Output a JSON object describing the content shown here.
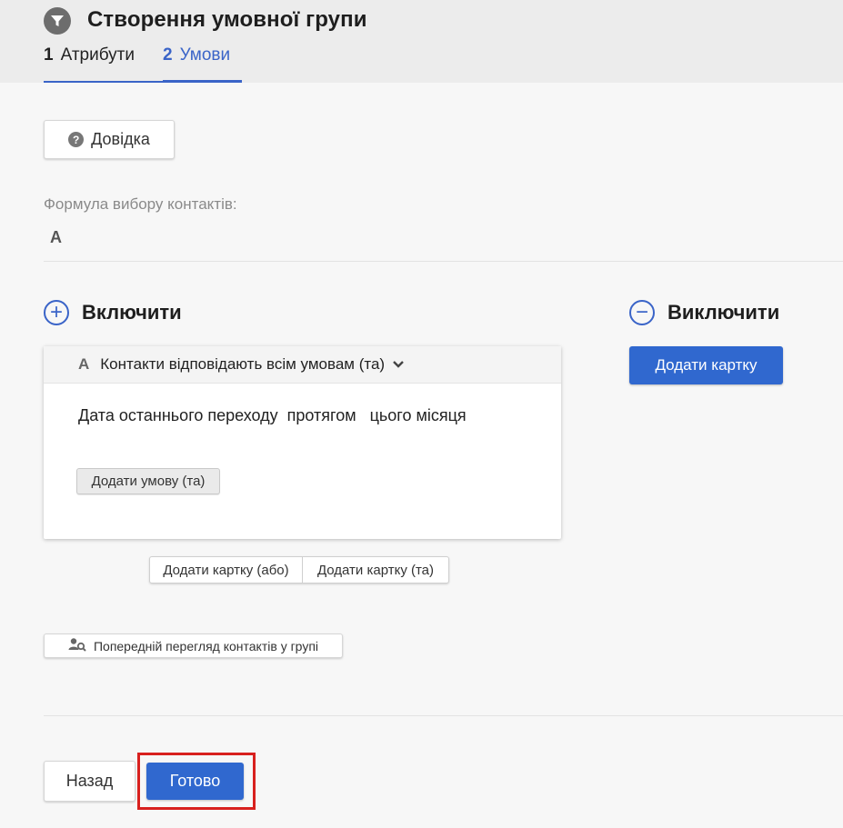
{
  "header": {
    "title": "Створення умовної групи",
    "steps": [
      {
        "num": "1",
        "label": "Атрибути"
      },
      {
        "num": "2",
        "label": "Умови"
      }
    ]
  },
  "help_button": {
    "label": "Довідка"
  },
  "formula": {
    "label": "Формула вибору контактів:",
    "value": "A"
  },
  "include": {
    "title": "Включити",
    "card": {
      "letter": "A",
      "header": "Контакти відповідають всім умовам (та)",
      "condition": "Дата останнього переходу  протягом   цього місяця",
      "add_condition": "Додати умову (та)"
    },
    "add_card_or": "Додати картку (або)",
    "add_card_and": "Додати картку (та)"
  },
  "exclude": {
    "title": "Виключити",
    "add_card": "Додати картку"
  },
  "preview_button": {
    "label": "Попередній перегляд контактів у групі"
  },
  "footer": {
    "back": "Назад",
    "done": "Готово"
  },
  "colors": {
    "accent": "#3068cf",
    "highlight": "#d8201e"
  },
  "icons": [
    "funnel-icon",
    "question-icon",
    "plus-circle-icon",
    "minus-circle-icon",
    "chevron-down-icon",
    "user-search-icon"
  ]
}
